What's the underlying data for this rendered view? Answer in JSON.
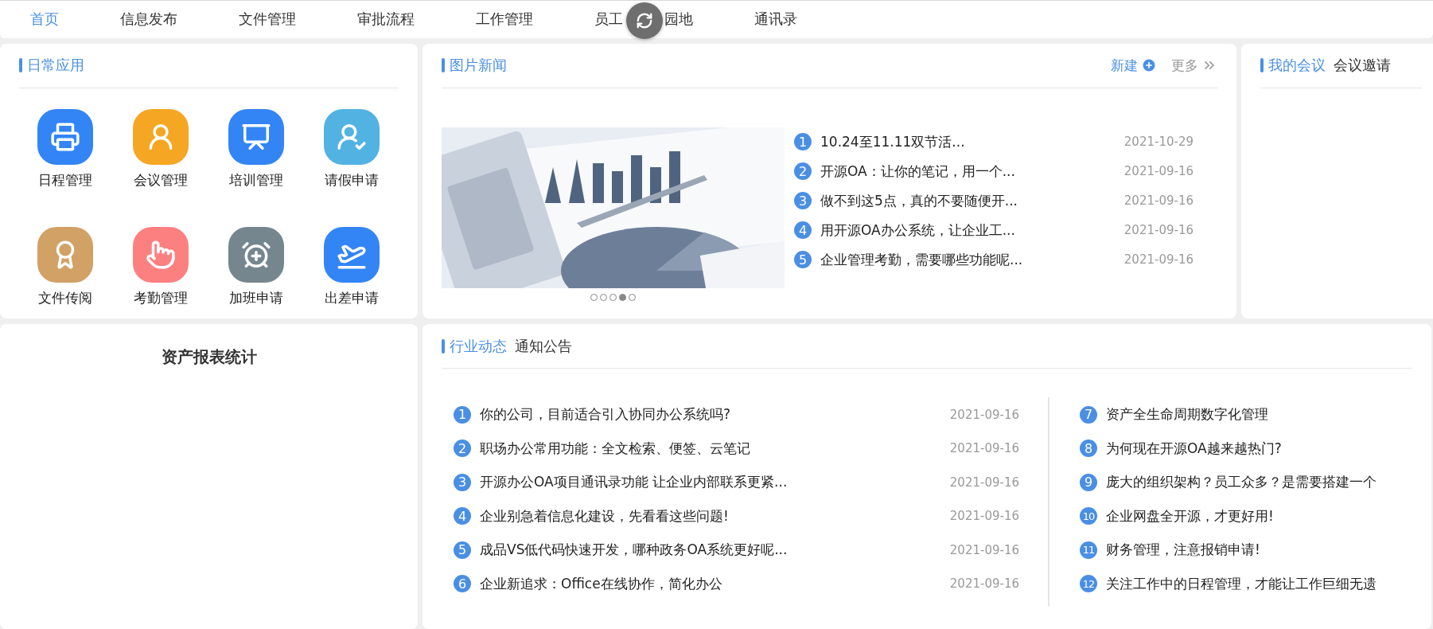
{
  "nav": {
    "items": [
      {
        "label": "首页",
        "selected": true
      },
      {
        "label": "信息发布",
        "selected": false
      },
      {
        "label": "文件管理",
        "selected": false
      },
      {
        "label": "审批流程",
        "selected": false
      },
      {
        "label": "工作管理",
        "selected": false
      },
      {
        "label": "员工",
        "label_after_cover": "园地",
        "selected": false
      },
      {
        "label": "通讯录",
        "selected": false
      }
    ]
  },
  "daily_apps": {
    "title": "日常应用",
    "apps": [
      {
        "label": "日程管理",
        "color": "#3385f6"
      },
      {
        "label": "会议管理",
        "color": "#f5a623"
      },
      {
        "label": "培训管理",
        "color": "#3385f6"
      },
      {
        "label": "请假申请",
        "color": "#52b2e2"
      },
      {
        "label": "文件传阅",
        "color": "#d2a166"
      },
      {
        "label": "考勤管理",
        "color": "#fd8081"
      },
      {
        "label": "加班申请",
        "color": "#75868f"
      },
      {
        "label": "出差申请",
        "color": "#3385f6"
      }
    ]
  },
  "photo_news": {
    "title": "图片新闻",
    "new_label": "新建",
    "more_label": "更多",
    "dots": [
      {
        "selected": false
      },
      {
        "selected": false
      },
      {
        "selected": false
      },
      {
        "selected": true
      },
      {
        "selected": false
      }
    ],
    "items": [
      {
        "number": "1",
        "title": "10.24至11.11双节活...",
        "date": "2021-10-29"
      },
      {
        "number": "2",
        "title": "开源OA：让你的笔记，用一个...",
        "date": "2021-09-16"
      },
      {
        "number": "3",
        "title": "做不到这5点，真的不要随便开...",
        "date": "2021-09-16"
      },
      {
        "number": "4",
        "title": "用开源OA办公系统，让企业工...",
        "date": "2021-09-16"
      },
      {
        "number": "5",
        "title": "企业管理考勤，需要哪些功能呢...",
        "date": "2021-09-16"
      }
    ]
  },
  "meetings": {
    "tabs": [
      {
        "label": "我的会议",
        "selected": true
      },
      {
        "label": "会议邀请",
        "selected": false
      }
    ]
  },
  "asset_report": {
    "title": "资产报表统计"
  },
  "news": {
    "tabs": [
      {
        "label": "行业动态",
        "selected": true
      },
      {
        "label": "通知公告",
        "selected": false
      }
    ],
    "left_items": [
      {
        "number": "1",
        "title": "你的公司，目前适合引入协同办公系统吗?",
        "date": "2021-09-16"
      },
      {
        "number": "2",
        "title": "职场办公常用功能：全文检索、便签、云笔记",
        "date": "2021-09-16"
      },
      {
        "number": "3",
        "title": "开源办公OA项目通讯录功能 让企业内部联系更紧...",
        "date": "2021-09-16"
      },
      {
        "number": "4",
        "title": "企业别急着信息化建设，先看看这些问题!",
        "date": "2021-09-16"
      },
      {
        "number": "5",
        "title": "成品VS低代码快速开发，哪种政务OA系统更好呢...",
        "date": "2021-09-16"
      },
      {
        "number": "6",
        "title": "企业新追求：Office在线协作，简化办公",
        "date": "2021-09-16"
      }
    ],
    "right_items": [
      {
        "number": "7",
        "title": "资产全生命周期数字化管理"
      },
      {
        "number": "8",
        "title": "为何现在开源OA越来越热门?"
      },
      {
        "number": "9",
        "title": "庞大的组织架构？员工众多？是需要搭建一个"
      },
      {
        "number": "10",
        "title": "企业网盘全开源，才更好用!"
      },
      {
        "number": "11",
        "title": "财务管理，注意报销申请!"
      },
      {
        "number": "12",
        "title": "关注工作中的日程管理，才能让工作巨细无遗"
      }
    ]
  }
}
